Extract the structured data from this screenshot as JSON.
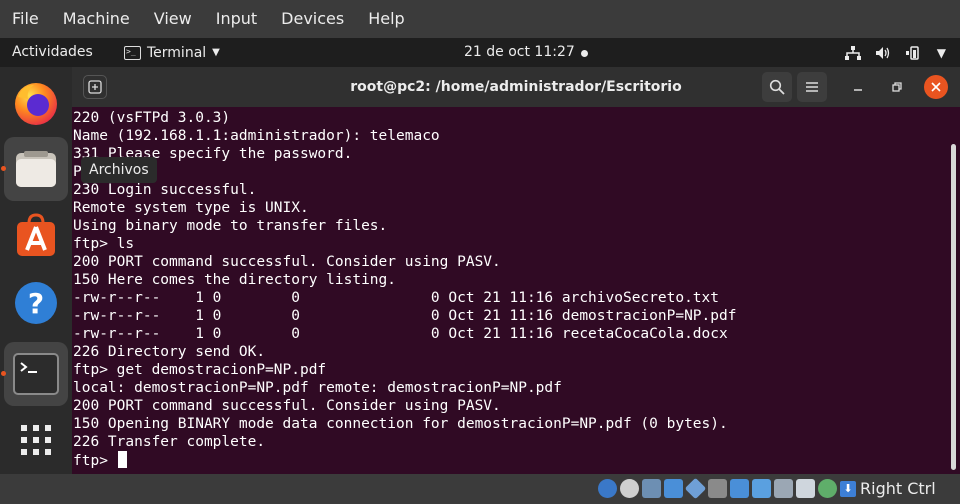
{
  "host_menu": [
    "File",
    "Machine",
    "View",
    "Input",
    "Devices",
    "Help"
  ],
  "topbar": {
    "activities": "Actividades",
    "app_name": "Terminal",
    "clock": "21 de oct  11:27"
  },
  "dock": {
    "items": [
      "Firefox",
      "Archivos",
      "Ubuntu Software",
      "Ayuda",
      "Terminal",
      "Mostrar aplicaciones"
    ],
    "tooltip": "Archivos"
  },
  "terminal": {
    "title": "root@pc2: /home/administrador/Escritorio",
    "lines": [
      "220 (vsFTPd 3.0.3)",
      "Name (192.168.1.1:administrador): telemaco",
      "331 Please specify the password.",
      "Password:",
      "230 Login successful.",
      "Remote system type is UNIX.",
      "Using binary mode to transfer files.",
      "ftp> ls",
      "200 PORT command successful. Consider using PASV.",
      "150 Here comes the directory listing.",
      "-rw-r--r--    1 0        0               0 Oct 21 11:16 archivoSecreto.txt",
      "-rw-r--r--    1 0        0               0 Oct 21 11:16 demostracionP=NP.pdf",
      "-rw-r--r--    1 0        0               0 Oct 21 11:16 recetaCocaCola.docx",
      "226 Directory send OK.",
      "ftp> get demostracionP=NP.pdf",
      "local: demostracionP=NP.pdf remote: demostracionP=NP.pdf",
      "200 PORT command successful. Consider using PASV.",
      "150 Opening BINARY mode data connection for demostracionP=NP.pdf (0 bytes).",
      "226 Transfer complete."
    ],
    "prompt": "ftp> "
  },
  "statusbar": {
    "host_key": "Right Ctrl"
  },
  "colors": {
    "terminal_bg": "#300a24",
    "accent": "#e95420"
  }
}
